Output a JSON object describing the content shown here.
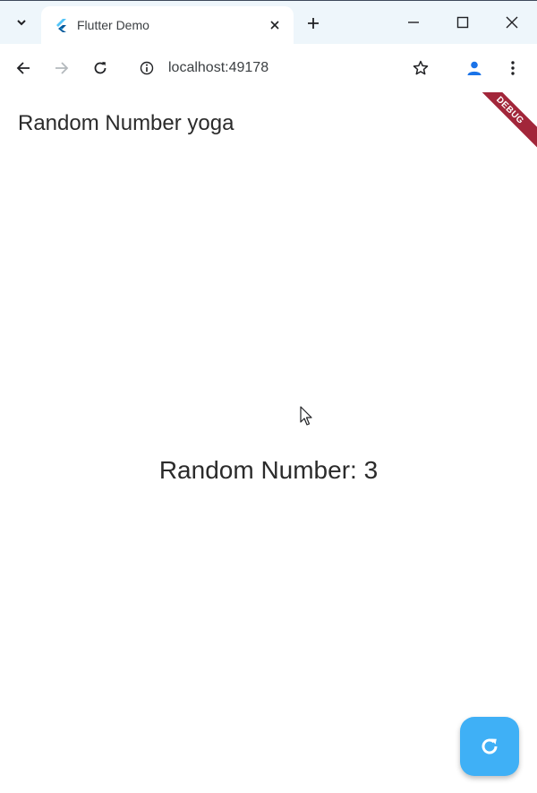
{
  "browser": {
    "tab": {
      "title": "Flutter Demo",
      "favicon": "flutter-logo-icon"
    },
    "icons": {
      "tab_search": "chevron-down-icon",
      "tab_close": "close-icon",
      "new_tab": "plus-icon",
      "minimize": "minimize-icon",
      "maximize": "maximize-icon",
      "close_window": "close-icon",
      "back": "arrow-left-icon",
      "forward": "arrow-right-icon",
      "reload": "reload-icon",
      "site_info": "info-icon",
      "bookmark": "star-icon",
      "profile": "person-icon",
      "menu": "kebab-menu-icon"
    },
    "address_bar": {
      "url": "localhost:49178"
    }
  },
  "app": {
    "title": "Random Number yoga",
    "debug_banner": "DEBUG",
    "random_number_text": "Random Number: 3",
    "fab_icon": "refresh-icon"
  },
  "colors": {
    "tabstrip_bg": "#eef6fb",
    "fab": "#3fb0f6",
    "debug_banner": "#a2263a",
    "profile_icon": "#1a73e8"
  }
}
